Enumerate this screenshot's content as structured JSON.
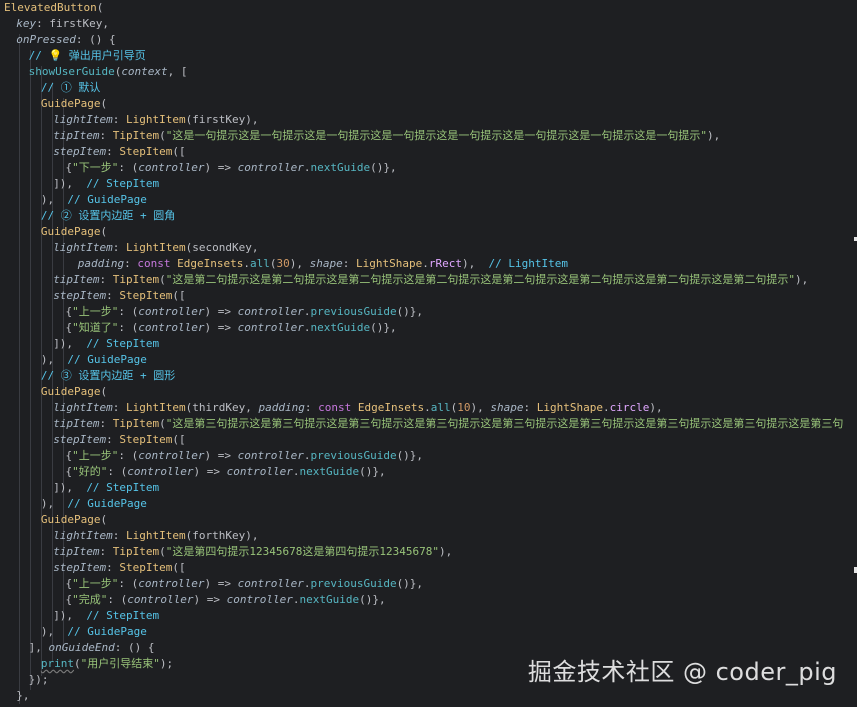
{
  "editor": {
    "lines": [
      [
        {
          "t": "ElevatedButton",
          "c": "c-cls"
        },
        {
          "t": "(",
          "c": "c-punc"
        }
      ],
      [
        {
          "t": "key",
          "c": "c-prm"
        },
        {
          "t": ": firstKey,",
          "c": "c-punc"
        }
      ],
      [
        {
          "t": "onPressed",
          "c": "c-prm"
        },
        {
          "t": ": () {",
          "c": "c-punc"
        }
      ],
      [
        {
          "t": "// ",
          "c": "c-com"
        },
        {
          "t": "💡",
          "c": "bulb"
        },
        {
          "t": " 弹出用户引导页",
          "c": "c-com"
        }
      ],
      [
        {
          "t": "showUserGuide",
          "c": "c-fn"
        },
        {
          "t": "(",
          "c": "c-punc"
        },
        {
          "t": "context",
          "c": "c-prm"
        },
        {
          "t": ", [",
          "c": "c-punc"
        }
      ],
      [
        {
          "t": "// ① 默认",
          "c": "c-com"
        }
      ],
      [
        {
          "t": "GuidePage",
          "c": "c-cls"
        },
        {
          "t": "(",
          "c": "c-punc"
        }
      ],
      [
        {
          "t": "lightItem",
          "c": "c-prm"
        },
        {
          "t": ": ",
          "c": "c-punc"
        },
        {
          "t": "LightItem",
          "c": "c-cls"
        },
        {
          "t": "(firstKey),",
          "c": "c-punc"
        }
      ],
      [
        {
          "t": "tipItem",
          "c": "c-prm"
        },
        {
          "t": ": ",
          "c": "c-punc"
        },
        {
          "t": "TipItem",
          "c": "c-cls"
        },
        {
          "t": "(",
          "c": "c-punc"
        },
        {
          "t": "\"这是一句提示这是一句提示这是一句提示这是一句提示这是一句提示这是一句提示这是一句提示这是一句提示\"",
          "c": "c-str"
        },
        {
          "t": "),",
          "c": "c-punc"
        }
      ],
      [
        {
          "t": "stepItem",
          "c": "c-prm"
        },
        {
          "t": ": ",
          "c": "c-punc"
        },
        {
          "t": "StepItem",
          "c": "c-cls"
        },
        {
          "t": "([",
          "c": "c-punc"
        }
      ],
      [
        {
          "t": "{",
          "c": "c-punc"
        },
        {
          "t": "\"下一步\"",
          "c": "c-str"
        },
        {
          "t": ": (",
          "c": "c-punc"
        },
        {
          "t": "controller",
          "c": "c-prm"
        },
        {
          "t": ") => ",
          "c": "c-punc"
        },
        {
          "t": "controller",
          "c": "c-prm"
        },
        {
          "t": ".",
          "c": "c-punc"
        },
        {
          "t": "nextGuide",
          "c": "c-fn"
        },
        {
          "t": "()},",
          "c": "c-punc"
        }
      ],
      [
        {
          "t": "]),  ",
          "c": "c-punc"
        },
        {
          "t": "// StepItem",
          "c": "c-com"
        }
      ],
      [
        {
          "t": "),  ",
          "c": "c-punc"
        },
        {
          "t": "// GuidePage",
          "c": "c-com"
        }
      ],
      [
        {
          "t": "// ② 设置内边距 + 圆角",
          "c": "c-com"
        }
      ],
      [
        {
          "t": "GuidePage",
          "c": "c-cls"
        },
        {
          "t": "(",
          "c": "c-punc"
        }
      ],
      [
        {
          "t": "lightItem",
          "c": "c-prm"
        },
        {
          "t": ": ",
          "c": "c-punc"
        },
        {
          "t": "LightItem",
          "c": "c-cls"
        },
        {
          "t": "(secondKey,",
          "c": "c-punc"
        }
      ],
      [
        {
          "t": "padding",
          "c": "c-prm"
        },
        {
          "t": ": ",
          "c": "c-punc"
        },
        {
          "t": "const ",
          "c": "c-kw"
        },
        {
          "t": "EdgeInsets",
          "c": "c-cls"
        },
        {
          "t": ".",
          "c": "c-punc"
        },
        {
          "t": "all",
          "c": "c-fn"
        },
        {
          "t": "(",
          "c": "c-punc"
        },
        {
          "t": "30",
          "c": "c-num"
        },
        {
          "t": "), ",
          "c": "c-punc"
        },
        {
          "t": "shape",
          "c": "c-prm"
        },
        {
          "t": ": ",
          "c": "c-punc"
        },
        {
          "t": "LightShape",
          "c": "c-cls"
        },
        {
          "t": ".",
          "c": "c-punc"
        },
        {
          "t": "rRect",
          "c": "c-enum"
        },
        {
          "t": "),  ",
          "c": "c-punc"
        },
        {
          "t": "// LightItem",
          "c": "c-com"
        }
      ],
      [
        {
          "t": "tipItem",
          "c": "c-prm"
        },
        {
          "t": ": ",
          "c": "c-punc"
        },
        {
          "t": "TipItem",
          "c": "c-cls"
        },
        {
          "t": "(",
          "c": "c-punc"
        },
        {
          "t": "\"这是第二句提示这是第二句提示这是第二句提示这是第二句提示这是第二句提示这是第二句提示这是第二句提示这是第二句提示\"",
          "c": "c-str"
        },
        {
          "t": "),",
          "c": "c-punc"
        }
      ],
      [
        {
          "t": "stepItem",
          "c": "c-prm"
        },
        {
          "t": ": ",
          "c": "c-punc"
        },
        {
          "t": "StepItem",
          "c": "c-cls"
        },
        {
          "t": "([",
          "c": "c-punc"
        }
      ],
      [
        {
          "t": "{",
          "c": "c-punc"
        },
        {
          "t": "\"上一步\"",
          "c": "c-str"
        },
        {
          "t": ": (",
          "c": "c-punc"
        },
        {
          "t": "controller",
          "c": "c-prm"
        },
        {
          "t": ") => ",
          "c": "c-punc"
        },
        {
          "t": "controller",
          "c": "c-prm"
        },
        {
          "t": ".",
          "c": "c-punc"
        },
        {
          "t": "previousGuide",
          "c": "c-fn"
        },
        {
          "t": "()},",
          "c": "c-punc"
        }
      ],
      [
        {
          "t": "{",
          "c": "c-punc"
        },
        {
          "t": "\"知道了\"",
          "c": "c-str"
        },
        {
          "t": ": (",
          "c": "c-punc"
        },
        {
          "t": "controller",
          "c": "c-prm"
        },
        {
          "t": ") => ",
          "c": "c-punc"
        },
        {
          "t": "controller",
          "c": "c-prm"
        },
        {
          "t": ".",
          "c": "c-punc"
        },
        {
          "t": "nextGuide",
          "c": "c-fn"
        },
        {
          "t": "()},",
          "c": "c-punc"
        }
      ],
      [
        {
          "t": "]),  ",
          "c": "c-punc"
        },
        {
          "t": "// StepItem",
          "c": "c-com"
        }
      ],
      [
        {
          "t": "),  ",
          "c": "c-punc"
        },
        {
          "t": "// GuidePage",
          "c": "c-com"
        }
      ],
      [
        {
          "t": "// ③ 设置内边距 + 圆形",
          "c": "c-com"
        }
      ],
      [
        {
          "t": "GuidePage",
          "c": "c-cls"
        },
        {
          "t": "(",
          "c": "c-punc"
        }
      ],
      [
        {
          "t": "lightItem",
          "c": "c-prm"
        },
        {
          "t": ": ",
          "c": "c-punc"
        },
        {
          "t": "LightItem",
          "c": "c-cls"
        },
        {
          "t": "(thirdKey, ",
          "c": "c-punc"
        },
        {
          "t": "padding",
          "c": "c-prm"
        },
        {
          "t": ": ",
          "c": "c-punc"
        },
        {
          "t": "const ",
          "c": "c-kw"
        },
        {
          "t": "EdgeInsets",
          "c": "c-cls"
        },
        {
          "t": ".",
          "c": "c-punc"
        },
        {
          "t": "all",
          "c": "c-fn"
        },
        {
          "t": "(",
          "c": "c-punc"
        },
        {
          "t": "10",
          "c": "c-num"
        },
        {
          "t": "), ",
          "c": "c-punc"
        },
        {
          "t": "shape",
          "c": "c-prm"
        },
        {
          "t": ": ",
          "c": "c-punc"
        },
        {
          "t": "LightShape",
          "c": "c-cls"
        },
        {
          "t": ".",
          "c": "c-punc"
        },
        {
          "t": "circle",
          "c": "c-enum"
        },
        {
          "t": "),",
          "c": "c-punc"
        }
      ],
      [
        {
          "t": "tipItem",
          "c": "c-prm"
        },
        {
          "t": ": ",
          "c": "c-punc"
        },
        {
          "t": "TipItem",
          "c": "c-cls"
        },
        {
          "t": "(",
          "c": "c-punc"
        },
        {
          "t": "\"这是第三句提示这是第三句提示这是第三句提示这是第三句提示这是第三句提示这是第三句提示这是第三句提示这是第三句提示这是第三句",
          "c": "c-str"
        }
      ],
      [
        {
          "t": "stepItem",
          "c": "c-prm"
        },
        {
          "t": ": ",
          "c": "c-punc"
        },
        {
          "t": "StepItem",
          "c": "c-cls"
        },
        {
          "t": "([",
          "c": "c-punc"
        }
      ],
      [
        {
          "t": "{",
          "c": "c-punc"
        },
        {
          "t": "\"上一步\"",
          "c": "c-str"
        },
        {
          "t": ": (",
          "c": "c-punc"
        },
        {
          "t": "controller",
          "c": "c-prm"
        },
        {
          "t": ") => ",
          "c": "c-punc"
        },
        {
          "t": "controller",
          "c": "c-prm"
        },
        {
          "t": ".",
          "c": "c-punc"
        },
        {
          "t": "previousGuide",
          "c": "c-fn"
        },
        {
          "t": "()},",
          "c": "c-punc"
        }
      ],
      [
        {
          "t": "{",
          "c": "c-punc"
        },
        {
          "t": "\"好的\"",
          "c": "c-str"
        },
        {
          "t": ": (",
          "c": "c-punc"
        },
        {
          "t": "controller",
          "c": "c-prm"
        },
        {
          "t": ") => ",
          "c": "c-punc"
        },
        {
          "t": "controller",
          "c": "c-prm"
        },
        {
          "t": ".",
          "c": "c-punc"
        },
        {
          "t": "nextGuide",
          "c": "c-fn"
        },
        {
          "t": "()},",
          "c": "c-punc"
        }
      ],
      [
        {
          "t": "]),  ",
          "c": "c-punc"
        },
        {
          "t": "// StepItem",
          "c": "c-com"
        }
      ],
      [
        {
          "t": "),  ",
          "c": "c-punc"
        },
        {
          "t": "// GuidePage",
          "c": "c-com"
        }
      ],
      [
        {
          "t": "GuidePage",
          "c": "c-cls"
        },
        {
          "t": "(",
          "c": "c-punc"
        }
      ],
      [
        {
          "t": "lightItem",
          "c": "c-prm"
        },
        {
          "t": ": ",
          "c": "c-punc"
        },
        {
          "t": "LightItem",
          "c": "c-cls"
        },
        {
          "t": "(forthKey),",
          "c": "c-punc"
        }
      ],
      [
        {
          "t": "tipItem",
          "c": "c-prm"
        },
        {
          "t": ": ",
          "c": "c-punc"
        },
        {
          "t": "TipItem",
          "c": "c-cls"
        },
        {
          "t": "(",
          "c": "c-punc"
        },
        {
          "t": "\"这是第四句提示12345678这是第四句提示12345678\"",
          "c": "c-str"
        },
        {
          "t": "),",
          "c": "c-punc"
        }
      ],
      [
        {
          "t": "stepItem",
          "c": "c-prm"
        },
        {
          "t": ": ",
          "c": "c-punc"
        },
        {
          "t": "StepItem",
          "c": "c-cls"
        },
        {
          "t": "([",
          "c": "c-punc"
        }
      ],
      [
        {
          "t": "{",
          "c": "c-punc"
        },
        {
          "t": "\"上一步\"",
          "c": "c-str"
        },
        {
          "t": ": (",
          "c": "c-punc"
        },
        {
          "t": "controller",
          "c": "c-prm"
        },
        {
          "t": ") => ",
          "c": "c-punc"
        },
        {
          "t": "controller",
          "c": "c-prm"
        },
        {
          "t": ".",
          "c": "c-punc"
        },
        {
          "t": "previousGuide",
          "c": "c-fn"
        },
        {
          "t": "()},",
          "c": "c-punc"
        }
      ],
      [
        {
          "t": "{",
          "c": "c-punc"
        },
        {
          "t": "\"完成\"",
          "c": "c-str"
        },
        {
          "t": ": (",
          "c": "c-punc"
        },
        {
          "t": "controller",
          "c": "c-prm"
        },
        {
          "t": ") => ",
          "c": "c-punc"
        },
        {
          "t": "controller",
          "c": "c-prm"
        },
        {
          "t": ".",
          "c": "c-punc"
        },
        {
          "t": "nextGuide",
          "c": "c-fn"
        },
        {
          "t": "()},",
          "c": "c-punc"
        }
      ],
      [
        {
          "t": "]),  ",
          "c": "c-punc"
        },
        {
          "t": "// StepItem",
          "c": "c-com"
        }
      ],
      [
        {
          "t": "),  ",
          "c": "c-punc"
        },
        {
          "t": "// GuidePage",
          "c": "c-com"
        }
      ],
      [
        {
          "t": "], ",
          "c": "c-punc"
        },
        {
          "t": "onGuideEnd",
          "c": "c-prm"
        },
        {
          "t": ": () {",
          "c": "c-punc"
        }
      ],
      [
        {
          "t": "print",
          "c": "c-fn underline"
        },
        {
          "t": "(",
          "c": "c-punc"
        },
        {
          "t": "\"用户引导结束\"",
          "c": "c-str"
        },
        {
          "t": ");",
          "c": "c-punc"
        }
      ],
      [
        {
          "t": "});",
          "c": "c-punc"
        }
      ],
      [
        {
          "t": "},",
          "c": "c-punc"
        }
      ]
    ]
  },
  "watermark": "掘金技术社区 @ coder_pig"
}
